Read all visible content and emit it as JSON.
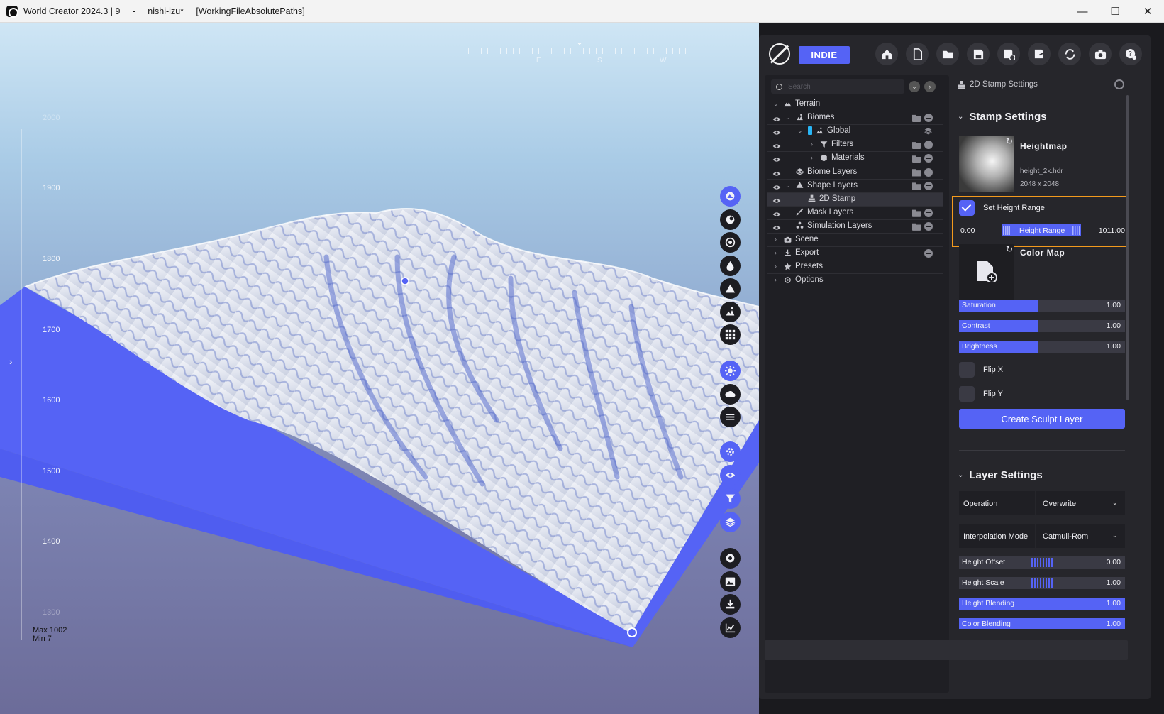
{
  "window": {
    "title": "World Creator 2024.3 | 9     -     nishi-izu*     [WorkingFileAbsolutePaths]",
    "minimize": "—",
    "maximize": "☐",
    "close": "✕"
  },
  "viewport": {
    "compass": [
      "E",
      "S",
      "W"
    ],
    "elevations": [
      "2000",
      "1900",
      "1800",
      "1700",
      "1600",
      "1500",
      "1400",
      "1300"
    ],
    "max_label": "Max 1002",
    "min_label": "Min 7",
    "tools_top": [
      "terrain-tool-icon",
      "sculpt-icon",
      "erosion-icon",
      "water-icon",
      "mountain-icon",
      "biome-icon",
      "grid-icon"
    ],
    "tools_mid": [
      "sun-icon",
      "cloud-icon",
      "fog-icon"
    ],
    "tools_low": [
      "settings-icon",
      "eye-icon",
      "filter-icon",
      "layers-icon"
    ],
    "tools_bottom": [
      "record-icon",
      "image-icon",
      "download-icon",
      "chart-icon"
    ]
  },
  "app": {
    "badge": "INDIE",
    "toolbar": [
      "home-icon",
      "new-file-icon",
      "open-folder-icon",
      "save-icon",
      "save-as-icon",
      "export-file-icon",
      "sync-icon",
      "camera-icon",
      "help-icon"
    ]
  },
  "tree": {
    "search_placeholder": "Search",
    "rows": [
      {
        "label": "Terrain",
        "indent": 0,
        "eye": false,
        "chev": "open",
        "icon": "terrain-icon",
        "folder": false,
        "plus": false
      },
      {
        "label": "Biomes",
        "indent": 1,
        "eye": true,
        "chev": "open",
        "icon": "biome-icon",
        "folder": true,
        "plus": true
      },
      {
        "label": "Global",
        "indent": 2,
        "eye": true,
        "chev": "open",
        "icon": "biome-icon",
        "folder": false,
        "plus": false
      },
      {
        "label": "Filters",
        "indent": 3,
        "eye": true,
        "chev": "closed",
        "icon": "filter-icon",
        "folder": true,
        "plus": true
      },
      {
        "label": "Materials",
        "indent": 3,
        "eye": true,
        "chev": "closed",
        "icon": "material-icon",
        "folder": true,
        "plus": true
      },
      {
        "label": "Biome Layers",
        "indent": 1,
        "eye": true,
        "chev": "none",
        "icon": "layers-icon",
        "folder": true,
        "plus": true
      },
      {
        "label": "Shape Layers",
        "indent": 1,
        "eye": true,
        "chev": "open",
        "icon": "mountain-icon",
        "folder": true,
        "plus": true
      },
      {
        "label": "2D Stamp",
        "indent": 2,
        "eye": true,
        "chev": "none",
        "icon": "stamp-icon",
        "folder": false,
        "plus": false
      },
      {
        "label": "Mask Layers",
        "indent": 1,
        "eye": true,
        "chev": "none",
        "icon": "brush-icon",
        "folder": true,
        "plus": true
      },
      {
        "label": "Simulation Layers",
        "indent": 1,
        "eye": true,
        "chev": "none",
        "icon": "simulation-icon",
        "folder": true,
        "plus": true
      },
      {
        "label": "Scene",
        "indent": 0,
        "eye": false,
        "chev": "closed",
        "icon": "camera-icon",
        "folder": false,
        "plus": false
      },
      {
        "label": "Export",
        "indent": 0,
        "eye": false,
        "chev": "closed",
        "icon": "download-icon",
        "folder": false,
        "plus": true
      },
      {
        "label": "Presets",
        "indent": 0,
        "eye": false,
        "chev": "closed",
        "icon": "star-icon",
        "folder": false,
        "plus": false
      },
      {
        "label": "Options",
        "indent": 0,
        "eye": false,
        "chev": "closed",
        "icon": "gear-icon",
        "folder": false,
        "plus": false
      }
    ]
  },
  "settings": {
    "header": "2D Stamp Settings",
    "stamp_title": "Stamp Settings",
    "heightmap": {
      "title": "Heightmap",
      "file": "height_2k.hdr",
      "size": "2048 x 2048"
    },
    "set_height_range": "Set Height Range",
    "height_range": {
      "min": "0.00",
      "label": "Height Range",
      "max": "1011.00"
    },
    "color_map_title": "Color Map",
    "color_sliders": [
      {
        "name": "Saturation",
        "value": "1.00",
        "fill": 0.48
      },
      {
        "name": "Contrast",
        "value": "1.00",
        "fill": 0.48
      },
      {
        "name": "Brightness",
        "value": "1.00",
        "fill": 0.48
      }
    ],
    "flip_x": "Flip X",
    "flip_y": "Flip Y",
    "create_button": "Create Sculpt Layer",
    "layer_title": "Layer Settings",
    "operation": {
      "label": "Operation",
      "value": "Overwrite"
    },
    "interpolation": {
      "label": "Interpolation Mode",
      "value": "Catmull-Rom"
    },
    "layer_sliders": [
      {
        "name": "Height Offset",
        "value": "0.00",
        "fill": 0,
        "center": true
      },
      {
        "name": "Height Scale",
        "value": "1.00",
        "fill": 0,
        "center": true
      },
      {
        "name": "Height Blending",
        "value": "1.00",
        "fill": 1,
        "center": false
      },
      {
        "name": "Color Blending",
        "value": "1.00",
        "fill": 1,
        "center": false
      }
    ]
  },
  "colors": {
    "accent": "#5563f5",
    "highlight": "#f39a1d",
    "panel": "#26262b"
  }
}
